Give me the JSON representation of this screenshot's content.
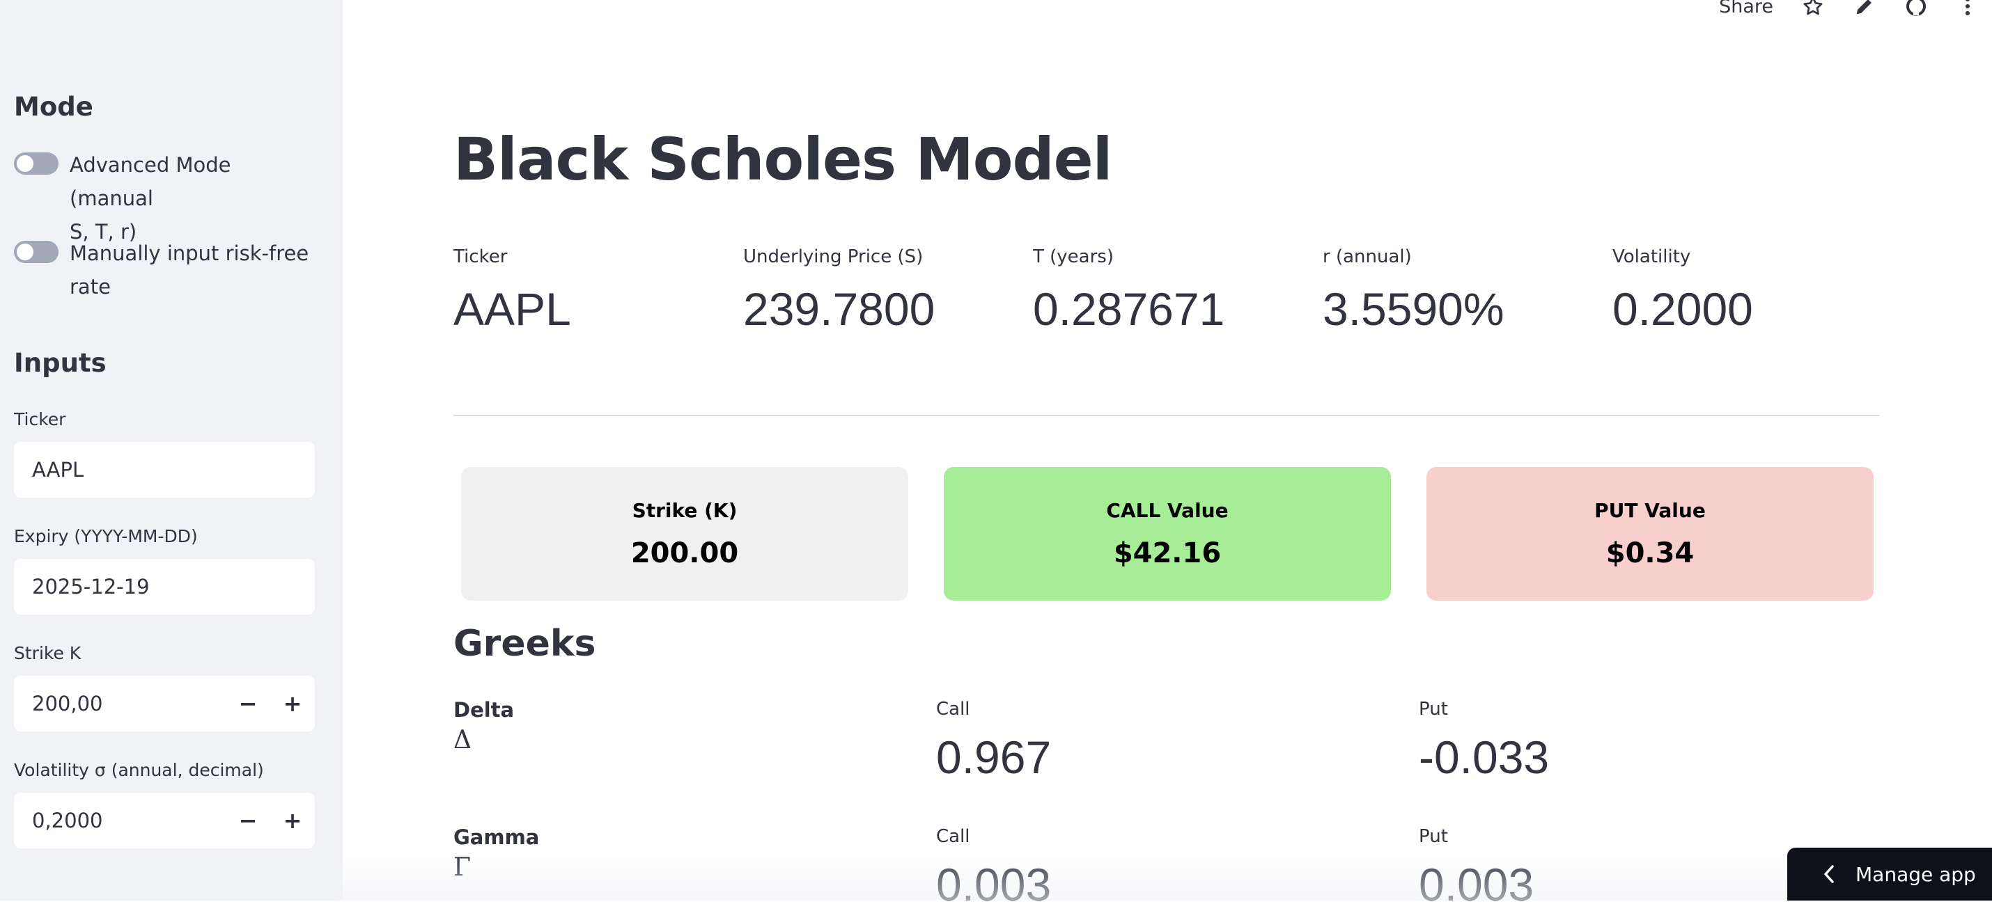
{
  "sidebar": {
    "mode_heading": "Mode",
    "toggles": [
      {
        "label_line1": "Advanced Mode (manual",
        "label_line2": "S, T, r)",
        "on": false
      },
      {
        "label_line1": "Manually input risk-free",
        "label_line2": "rate",
        "on": false
      }
    ],
    "inputs_heading": "Inputs",
    "ticker": {
      "label": "Ticker",
      "value": "AAPL"
    },
    "expiry": {
      "label": "Expiry (YYYY-MM-DD)",
      "value": "2025-12-19"
    },
    "strike": {
      "label": "Strike K",
      "value": "200,00",
      "minus": "−",
      "plus": "+"
    },
    "volatility": {
      "label": "Volatility σ (annual, decimal)",
      "value": "0,2000",
      "minus": "−",
      "plus": "+"
    }
  },
  "toolbar": {
    "share": "Share",
    "icons": [
      "star-icon",
      "pencil-icon",
      "github-icon",
      "more-vertical-icon"
    ]
  },
  "main": {
    "title": "Black Scholes Model",
    "metrics": [
      {
        "label": "Ticker",
        "value": "AAPL"
      },
      {
        "label": "Underlying Price (S)",
        "value": "239.7800"
      },
      {
        "label": "T (years)",
        "value": "0.287671"
      },
      {
        "label": "r (annual)",
        "value": "3.5590%"
      },
      {
        "label": "Volatility",
        "value": "0.2000"
      }
    ],
    "cards": [
      {
        "label": "Strike (K)",
        "value": "200.00",
        "color": "#f0f0f0"
      },
      {
        "label": "CALL Value",
        "value": "$42.16",
        "color": "#a7ed98"
      },
      {
        "label": "PUT Value",
        "value": "$0.34",
        "color": "#f7cfcd"
      }
    ],
    "greeks_heading": "Greeks",
    "greeks": [
      {
        "name": "Delta",
        "symbol": "Δ",
        "call_label": "Call",
        "call": "0.967",
        "put_label": "Put",
        "put": "-0.033"
      },
      {
        "name": "Gamma",
        "symbol": "Γ",
        "call_label": "Call",
        "call": "0.003",
        "put_label": "Put",
        "put": "0.003"
      }
    ]
  },
  "manage_app": {
    "label": "Manage app"
  }
}
